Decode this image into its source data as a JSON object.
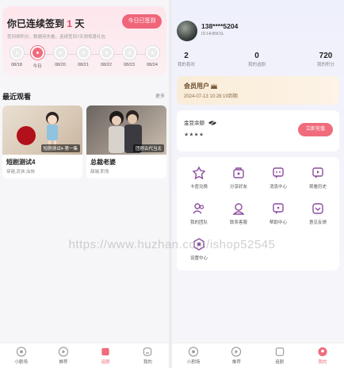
{
  "checkin": {
    "title_prefix": "你已连续签到",
    "days": "1",
    "title_suffix": "天",
    "subtitle": "签到得积分，数据持先看，连续签到7天领惊喜礼包",
    "button": "今日已签到",
    "dates": [
      "08/18",
      "今日",
      "08/20",
      "08/21",
      "08/22",
      "08/23",
      "08/24"
    ],
    "active_index": 1
  },
  "recent": {
    "title": "最近观看",
    "more": "更多",
    "items": [
      {
        "thumb_caption": "短剧测试4-第一集",
        "title": "短剧测试4",
        "tags": "穿越,武侠,仙侠"
      },
      {
        "thumb_caption": "团剧古代当太",
        "title": "总裁老婆",
        "tags": "甜端,职场"
      }
    ]
  },
  "tabbar_left": {
    "items": [
      {
        "label": "小剧场",
        "icon": "theater-icon"
      },
      {
        "label": "推荐",
        "icon": "play-icon"
      },
      {
        "label": "追剧",
        "icon": "bookmark-icon"
      },
      {
        "label": "我的",
        "icon": "profile-icon"
      }
    ],
    "active_index": 2
  },
  "profile": {
    "phone": "138****5204",
    "id": "ID:HHBKSL",
    "stats": [
      {
        "value": "2",
        "label": "我的喜欢"
      },
      {
        "value": "0",
        "label": "我的追剧"
      },
      {
        "value": "720",
        "label": "我的积分"
      }
    ],
    "member_title": "会员用户",
    "member_expiry": "2024-07-13 10:28:19到期",
    "balance_label": "金豆余额",
    "balance_value": "****",
    "recharge_button": "立即充值"
  },
  "menu": {
    "items": [
      {
        "label": "卡密兑换",
        "icon": "gift-card-icon"
      },
      {
        "label": "分享好友",
        "icon": "share-icon"
      },
      {
        "label": "消息中心",
        "icon": "message-icon"
      },
      {
        "label": "观看历史",
        "icon": "history-icon"
      },
      {
        "label": "我的团队",
        "icon": "team-icon"
      },
      {
        "label": "联系客服",
        "icon": "customer-service-icon"
      },
      {
        "label": "帮助中心",
        "icon": "help-icon"
      },
      {
        "label": "意见反馈",
        "icon": "feedback-icon"
      },
      {
        "label": "设置中心",
        "icon": "settings-icon"
      }
    ]
  },
  "tabbar_right": {
    "items": [
      {
        "label": "小剧场",
        "icon": "theater-icon"
      },
      {
        "label": "推荐",
        "icon": "play-icon"
      },
      {
        "label": "追剧",
        "icon": "bookmark-icon"
      },
      {
        "label": "我的",
        "icon": "profile-icon"
      }
    ],
    "active_index": 3
  },
  "watermark": "https://www.huzhan.com/ishop52545",
  "colors": {
    "accent": "#f06c7d",
    "member_bg": "#f9ecd8",
    "text_dark": "#222222",
    "text_muted": "#888888"
  }
}
